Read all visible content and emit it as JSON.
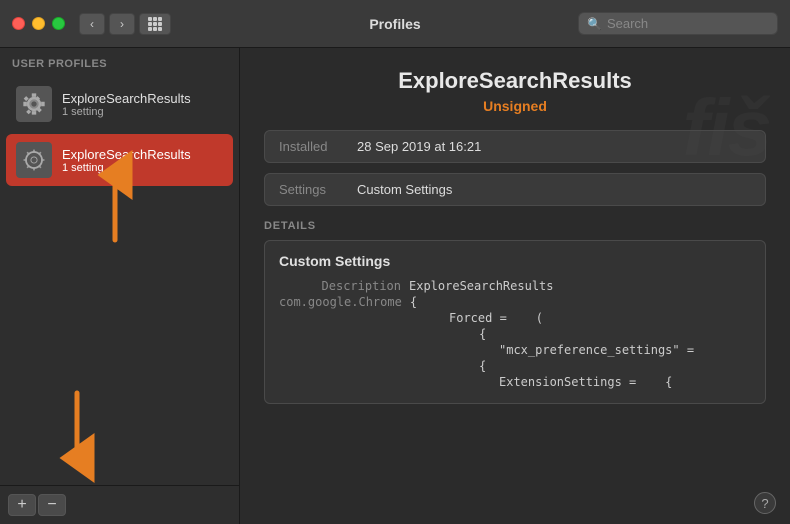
{
  "titlebar": {
    "title": "Profiles",
    "search_placeholder": "Search"
  },
  "sidebar": {
    "header": "User Profiles",
    "profiles": [
      {
        "name": "ExploreSearchResults",
        "setting": "1 setting",
        "selected": false
      },
      {
        "name": "ExploreSearchResults",
        "setting": "1 setting",
        "selected": true
      }
    ],
    "add_label": "+",
    "remove_label": "−"
  },
  "detail": {
    "title": "ExploreSearchResults",
    "subtitle": "Unsigned",
    "installed_label": "Installed",
    "installed_value": "28 Sep 2019 at 16:21",
    "settings_label": "Settings",
    "settings_value": "Custom Settings",
    "details_header": "DETAILS",
    "details_box_title": "Custom Settings",
    "desc_label": "Description",
    "desc_value": "ExploreSearchResults",
    "chrome_label": "com.google.Chrome",
    "code_lines": [
      {
        "indent": 0,
        "text": "{"
      },
      {
        "indent": 1,
        "text": "Forced =    ("
      },
      {
        "indent": 2,
        "text": "{"
      },
      {
        "indent": 3,
        "text": "\"mcx_preference_settings\" ="
      },
      {
        "indent": 2,
        "text": "{"
      },
      {
        "indent": 3,
        "text": "ExtensionSettings =    {"
      }
    ]
  },
  "watermark": "fiš",
  "help_label": "?"
}
